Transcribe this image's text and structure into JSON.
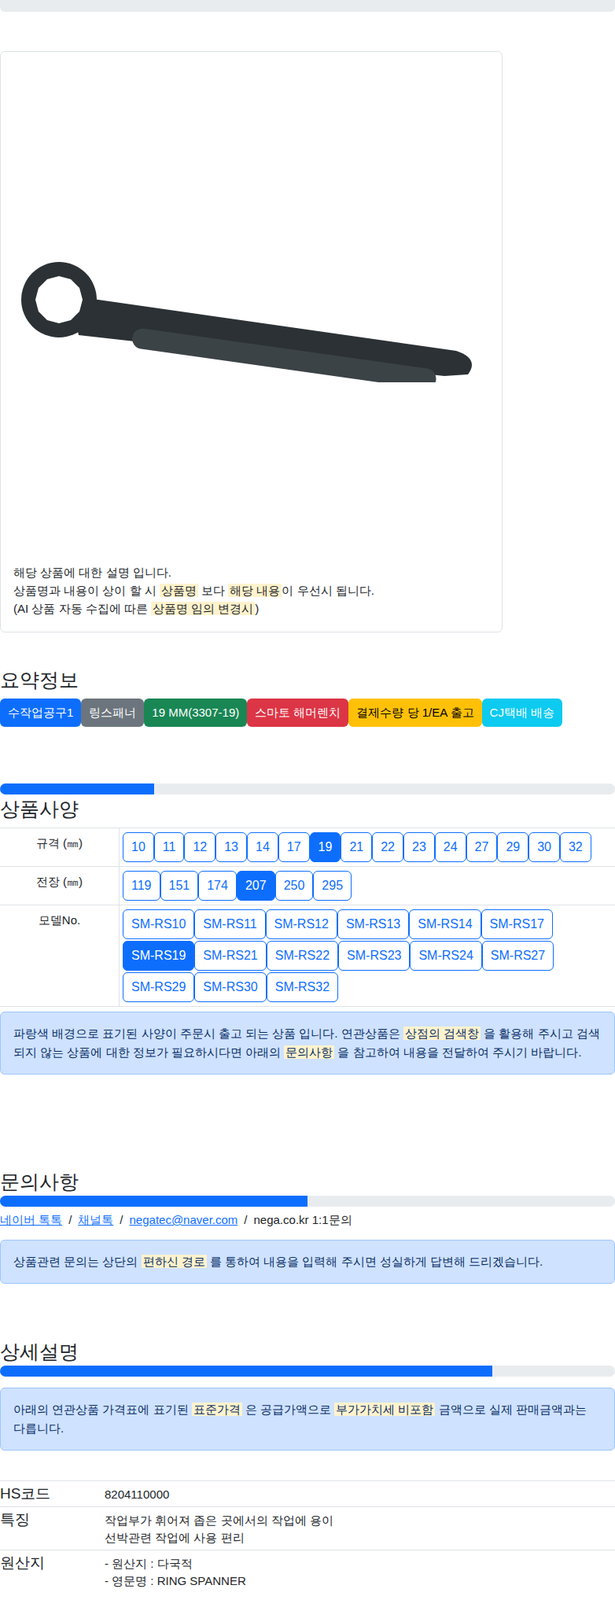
{
  "notice": {
    "lines": [
      [
        {
          "text": "해당 상품에 대한 설명 입니다.",
          "highlight": false
        }
      ],
      [
        {
          "text": "상품명과 내용이 상이 할 시 ",
          "highlight": false
        },
        {
          "text": "상품명",
          "highlight": true
        },
        {
          "text": " 보다 ",
          "highlight": false
        },
        {
          "text": "해당 내용",
          "highlight": true
        },
        {
          "text": "이 우선시 됩니다.",
          "highlight": false
        }
      ],
      [
        {
          "text": "(AI 상품 자동 수집에 따른 ",
          "highlight": false
        },
        {
          "text": "상품명 임의 변경시",
          "highlight": true
        },
        {
          "text": ")",
          "highlight": false
        }
      ]
    ]
  },
  "summary": {
    "title": "요약정보",
    "tags": [
      {
        "label": "수작업공구1",
        "color": "#0d6efd"
      },
      {
        "label": "링스패너",
        "color": "#6c757d"
      },
      {
        "label": "19 MM(3307-19)",
        "color": "#198754"
      },
      {
        "label": "스마토 해머렌치",
        "color": "#dc3545"
      },
      {
        "label": "결제수량 당 1/EA 출고",
        "color": "#ffc107"
      },
      {
        "label": "CJ택배 배송",
        "color": "#0dcaf0"
      }
    ]
  },
  "spec": {
    "title": "상품사양",
    "level": 0.25,
    "rows": [
      {
        "label": "규격 (㎜)",
        "options": [
          {
            "label": "10",
            "selected": false
          },
          {
            "label": "11",
            "selected": false
          },
          {
            "label": "12",
            "selected": false
          },
          {
            "label": "13",
            "selected": false
          },
          {
            "label": "14",
            "selected": false
          },
          {
            "label": "17",
            "selected": false
          },
          {
            "label": "19",
            "selected": true
          },
          {
            "label": "21",
            "selected": false
          },
          {
            "label": "22",
            "selected": false
          },
          {
            "label": "23",
            "selected": false
          },
          {
            "label": "24",
            "selected": false
          },
          {
            "label": "27",
            "selected": false
          },
          {
            "label": "29",
            "selected": false
          },
          {
            "label": "30",
            "selected": false
          },
          {
            "label": "32",
            "selected": false
          }
        ]
      },
      {
        "label": "전장 (㎜)",
        "options": [
          {
            "label": "119",
            "selected": false
          },
          {
            "label": "151",
            "selected": false
          },
          {
            "label": "174",
            "selected": false
          },
          {
            "label": "207",
            "selected": true
          },
          {
            "label": "250",
            "selected": false
          },
          {
            "label": "295",
            "selected": false
          }
        ]
      },
      {
        "label": "모델No.",
        "options": [
          {
            "label": "SM-RS10",
            "selected": false
          },
          {
            "label": "SM-RS11",
            "selected": false
          },
          {
            "label": "SM-RS12",
            "selected": false
          },
          {
            "label": "SM-RS13",
            "selected": false
          },
          {
            "label": "SM-RS14",
            "selected": false
          },
          {
            "label": "SM-RS17",
            "selected": false
          },
          {
            "label": "SM-RS19",
            "selected": true
          },
          {
            "label": "SM-RS21",
            "selected": false
          },
          {
            "label": "SM-RS22",
            "selected": false
          },
          {
            "label": "SM-RS23",
            "selected": false
          },
          {
            "label": "SM-RS24",
            "selected": false
          },
          {
            "label": "SM-RS27",
            "selected": false
          },
          {
            "label": "SM-RS29",
            "selected": false
          },
          {
            "label": "SM-RS30",
            "selected": false
          },
          {
            "label": "SM-RS32",
            "selected": false
          }
        ]
      }
    ],
    "alert": [
      {
        "text": "파랑색 배경으로 표기된 사양이 주문시 출고 되는 상품 입니다. 연관상품은 ",
        "highlight": false
      },
      {
        "text": "상점의 검색창",
        "highlight": true
      },
      {
        "text": " 을 활용해 주시고 검색되지 않는 상품에 대한 정보가 필요하시다면 아래의 ",
        "highlight": false
      },
      {
        "text": "문의사항",
        "highlight": true
      },
      {
        "text": " 을 참고하여 내용을 전달하여 주시기 바랍니다.",
        "highlight": false
      }
    ]
  },
  "inquiry": {
    "title": "문의사항",
    "level": 0.5,
    "separator": "/",
    "links": [
      {
        "label": "네이버 톡톡",
        "link": true
      },
      {
        "label": "채널톡",
        "link": true
      },
      {
        "label": "negatec@naver.com",
        "link": true
      },
      {
        "label": "nega.co.kr 1:1문의",
        "link": false
      }
    ],
    "alert": [
      {
        "text": "상품관련 문의는 상단의 ",
        "highlight": false
      },
      {
        "text": "편하신 경로",
        "highlight": true
      },
      {
        "text": " 를 통하여 내용을 입력해 주시면 성실하게 답변해 드리겠습니다.",
        "highlight": false
      }
    ]
  },
  "detail": {
    "title": "상세설명",
    "level": 0.8,
    "alert": [
      {
        "text": "아래의 연관상품 가격표에 표기된 ",
        "highlight": false
      },
      {
        "text": "표준가격",
        "highlight": true
      },
      {
        "text": " 은 공급가액으로 ",
        "highlight": false
      },
      {
        "text": "부가가치세 비포함",
        "highlight": true
      },
      {
        "text": " 금액으로 실제 판매금액과는 다릅니다.",
        "highlight": false
      }
    ],
    "rows": [
      {
        "label": "HS코드",
        "lines": [
          "8204110000"
        ]
      },
      {
        "label": "특징",
        "lines": [
          "작업부가 휘어져 좁은 곳에서의 작업에 용이",
          "선박관련 작업에 사용 편리"
        ]
      },
      {
        "label": "원산지",
        "lines": [
          "- 원산지 : 다국적",
          "- 영문명 : RING SPANNER"
        ]
      }
    ]
  }
}
